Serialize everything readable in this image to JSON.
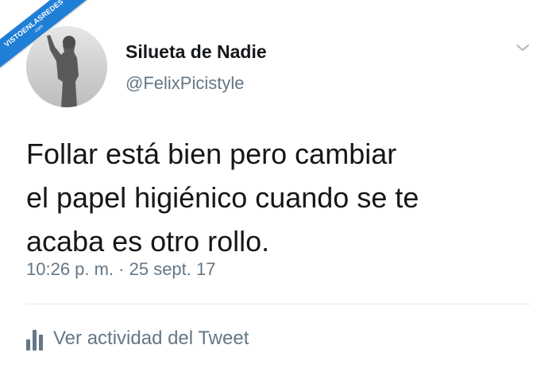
{
  "watermark": {
    "main": "VISTOENLASREDES",
    "sub": ".com"
  },
  "author": {
    "display_name": "Silueta de Nadie",
    "handle": "@FelixPicistyle",
    "avatar_icon": "silhouette-avatar"
  },
  "tweet": {
    "lines": [
      "Follar está bien pero cambiar",
      "el papel higiénico cuando se te",
      "acaba es otro rollo."
    ],
    "timestamp": "10:26 p. m. · 25 sept. 17"
  },
  "actions": {
    "menu_icon": "chevron-down-icon",
    "activity_icon": "bar-chart-icon",
    "activity_label": "Ver actividad del Tweet"
  },
  "colors": {
    "text_primary": "#14171a",
    "text_secondary": "#657786",
    "divider": "#e1e8ed",
    "watermark_bg": "#1f7fd6"
  }
}
